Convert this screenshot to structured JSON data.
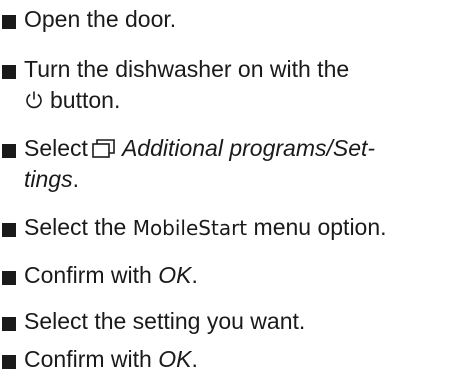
{
  "steps": [
    {
      "text": "Open the door."
    },
    {
      "line1": "Turn the dishwasher on with the",
      "icon": "power-icon",
      "line2_after_icon": "button."
    },
    {
      "before_icon": "Select",
      "icon": "programs-icon",
      "italic_line1": "Additional programs/Set-",
      "italic_line2": "tings",
      "after": "."
    },
    {
      "before": "Select the",
      "ui_term": "MobileStart",
      "after": "menu option."
    },
    {
      "before": "Confirm with",
      "italic": "OK",
      "after": "."
    },
    {
      "text": "Select the setting you want."
    },
    {
      "before": "Confirm with",
      "italic": "OK",
      "after": "."
    }
  ]
}
